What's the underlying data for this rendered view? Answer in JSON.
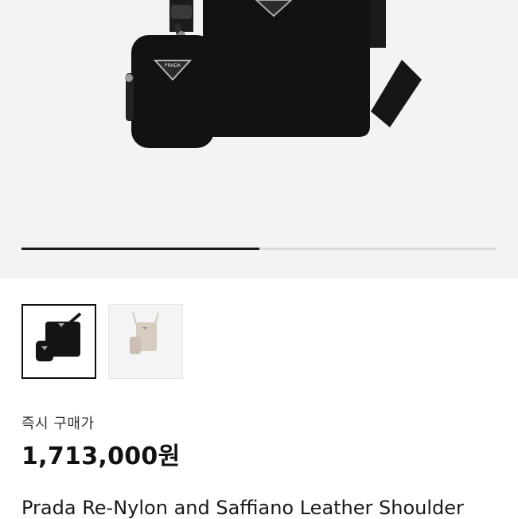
{
  "gallery": {
    "progress_fraction": 0.5,
    "thumbnails": [
      {
        "name": "black bag",
        "selected": true
      },
      {
        "name": "beige bag",
        "selected": false
      }
    ],
    "logo_text": "PRADA"
  },
  "product": {
    "price_label": "즉시 구매가",
    "price": "1,713,000원",
    "title": "Prada Re-Nylon and Saffiano Leather Shoulder"
  },
  "colors": {
    "hero_bg": "#f3f3f3",
    "bag_black": "#121212",
    "accent_dark": "#111111"
  }
}
